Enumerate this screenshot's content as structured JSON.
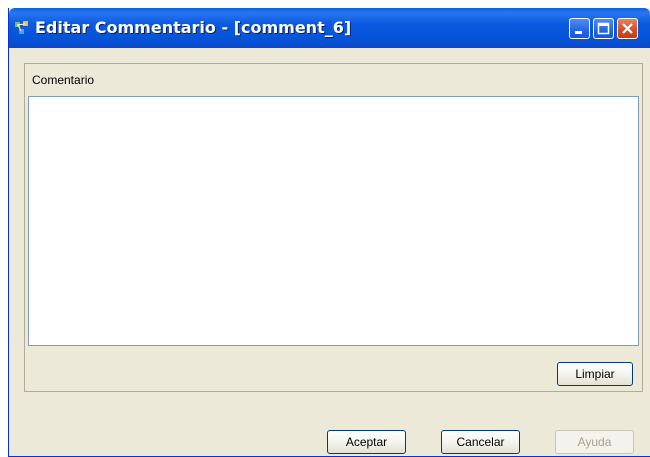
{
  "window": {
    "title": "Editar Commentario - [comment_6]"
  },
  "icons": {
    "app": "app-icon",
    "minimize": "minimize-icon",
    "maximize": "maximize-icon",
    "close": "close-icon"
  },
  "comment": {
    "label": "Comentario",
    "value": ""
  },
  "buttons": {
    "clear": "Limpiar",
    "accept": "Aceptar",
    "cancel": "Cancelar",
    "help": "Ayuda"
  },
  "colors": {
    "titlebar": "#0a5ee8",
    "window_bg": "#ece9d8",
    "close_button": "#d94b22"
  }
}
